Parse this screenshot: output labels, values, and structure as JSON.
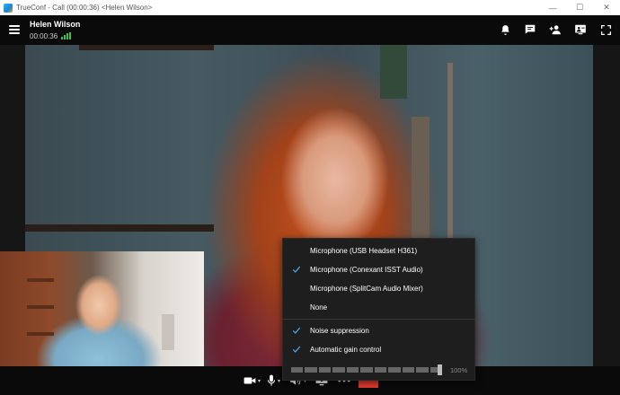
{
  "window": {
    "title": "TrueConf - Call (00:00:36) <Helen Wilson>",
    "minimize_glyph": "—",
    "maximize_glyph": "☐",
    "close_glyph": "✕"
  },
  "header": {
    "caller_name": "Helen Wilson",
    "timer": "00:00:36",
    "icons": [
      "bell-icon",
      "chat-icon",
      "add-user-icon",
      "slideshow-icon",
      "fullscreen-icon"
    ]
  },
  "mic_menu": {
    "devices": [
      {
        "label": "Microphone (USB Headset H361)",
        "checked": false
      },
      {
        "label": "Microphone (Conexant ISST Audio)",
        "checked": true
      },
      {
        "label": "Microphone (SplitCam Audio Mixer)",
        "checked": false
      },
      {
        "label": "None",
        "checked": false
      }
    ],
    "options": [
      {
        "label": "Noise suppression",
        "checked": true
      },
      {
        "label": "Automatic gain control",
        "checked": true
      }
    ],
    "volume_percent_label": "100%",
    "volume_level": 1.0
  },
  "toolbar": {
    "icons": [
      "camera-icon",
      "microphone-icon",
      "speaker-icon",
      "screen-share-icon",
      "more-icon",
      "end-call-icon"
    ]
  },
  "colors": {
    "accent_check": "#4aa3df",
    "signal": "#3cc24a",
    "end_call": "#e23b2e"
  }
}
